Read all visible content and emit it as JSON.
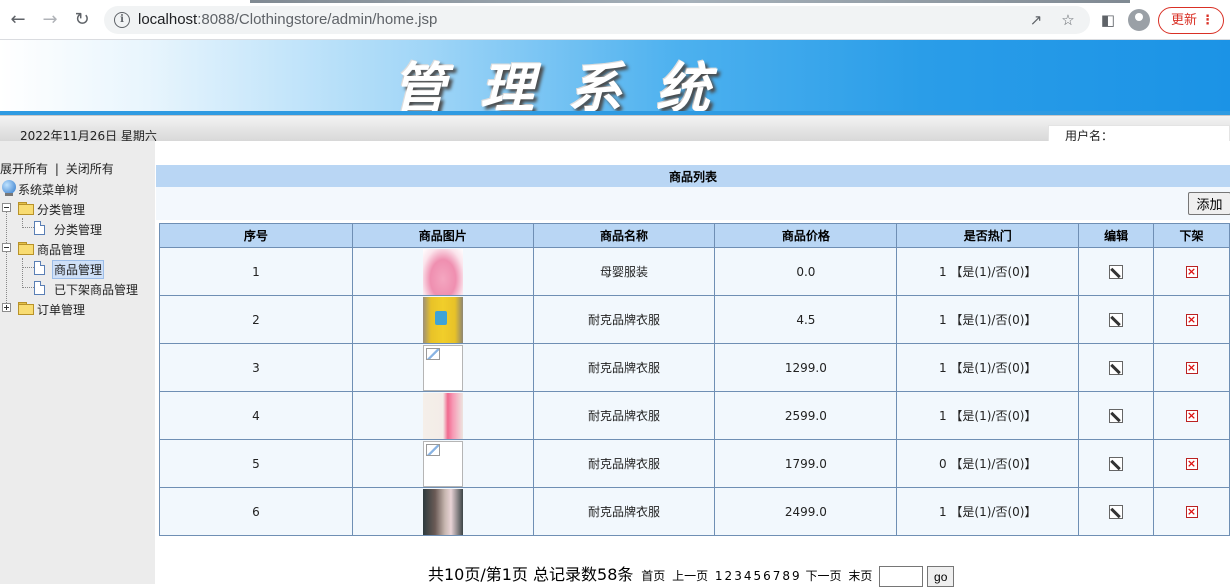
{
  "browser": {
    "url_host": "localhost",
    "url_rest": ":8088/Clothingstore/admin/home.jsp",
    "update_label": "更新"
  },
  "banner": {
    "title": "管理系统"
  },
  "datebar": {
    "date": "2022年11月26日 星期六",
    "user_label": "用户名："
  },
  "sidebar": {
    "expand_all": "展开所有",
    "separator": "|",
    "collapse_all": "关闭所有",
    "root": "系统菜单树",
    "nodes": [
      {
        "label": "分类管理",
        "children": [
          "分类管理"
        ]
      },
      {
        "label": "商品管理",
        "children": [
          "商品管理",
          "已下架商品管理"
        ]
      },
      {
        "label": "订单管理",
        "children": []
      }
    ]
  },
  "main": {
    "list_title": "商品列表",
    "add_button": "添加",
    "columns": [
      "序号",
      "商品图片",
      "商品名称",
      "商品价格",
      "是否热门",
      "编辑",
      "下架"
    ],
    "hot_suffix": "【是(1)/否(0)】",
    "rows": [
      {
        "id": "1",
        "image": "skirt",
        "name": "母婴服装",
        "price": "0.0",
        "hot": "1"
      },
      {
        "id": "2",
        "image": "tshirt",
        "name": "耐克品牌衣服",
        "price": "4.5",
        "hot": "1"
      },
      {
        "id": "3",
        "image": "broken",
        "name": "耐克品牌衣服",
        "price": "1299.0",
        "hot": "1"
      },
      {
        "id": "4",
        "image": "cosmetic",
        "name": "耐克品牌衣服",
        "price": "2599.0",
        "hot": "1"
      },
      {
        "id": "5",
        "image": "broken",
        "name": "耐克品牌衣服",
        "price": "1799.0",
        "hot": "0"
      },
      {
        "id": "6",
        "image": "couple",
        "name": "耐克品牌衣服",
        "price": "2499.0",
        "hot": "1"
      }
    ],
    "pager": {
      "summary": "共10页/第1页 总记录数58条",
      "first": "首页",
      "prev": "上一页",
      "pages": [
        "1",
        "2",
        "3",
        "4",
        "5",
        "6",
        "7",
        "8",
        "9"
      ],
      "next": "下一页",
      "last": "末页",
      "go": "go"
    }
  }
}
